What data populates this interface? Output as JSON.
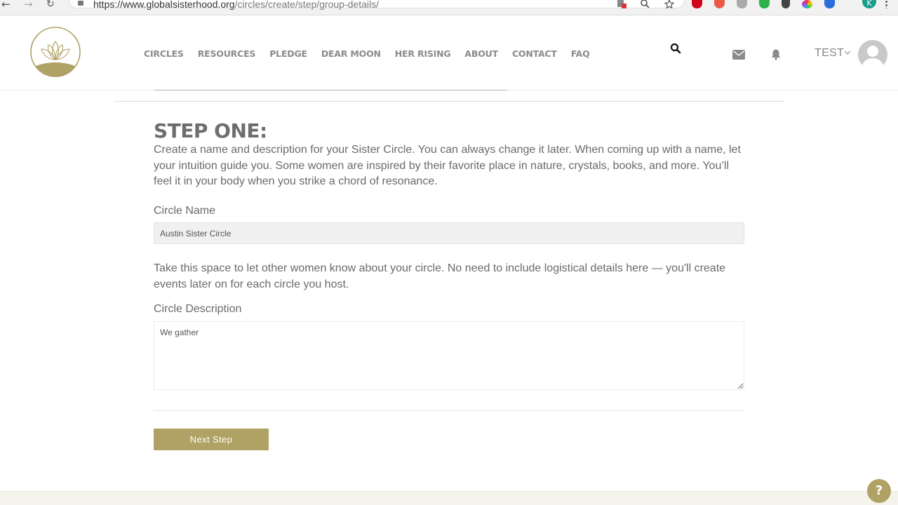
{
  "browser": {
    "url_host": "https://www.globalsisterhood.org",
    "url_path": "/circles/create/step/group-details/",
    "profile_initial": "K"
  },
  "header": {
    "nav": [
      {
        "label": "CIRCLES"
      },
      {
        "label": "RESOURCES"
      },
      {
        "label": "PLEDGE"
      },
      {
        "label": "DEAR MOON"
      },
      {
        "label": "HER RISING"
      },
      {
        "label": "ABOUT"
      },
      {
        "label": "CONTACT"
      },
      {
        "label": "FAQ"
      }
    ],
    "user_name": "TEST"
  },
  "form": {
    "step_title": "STEP ONE:",
    "intro": "Create a name and description for your Sister Circle. You can always change it later. When coming up with a name, let your intuition guide you. Some women are inspired by their favorite place in nature, crystals, books, and more. You’ll feel it in your body when you strike a chord of resonance.",
    "name_label": "Circle Name",
    "name_value": "Austin Sister Circle",
    "desc_help": "Take this space to let other women know about your circle. No need to include logistical details here — you'll create events later on for each circle you host.",
    "desc_label": "Circle Description",
    "desc_value": "We gather ",
    "next_label": "Next Step"
  },
  "help": {
    "label": "?"
  },
  "colors": {
    "brand_gold": "#b0a264",
    "nav_text": "#8b8b8b",
    "heading": "#6e6e6e"
  }
}
